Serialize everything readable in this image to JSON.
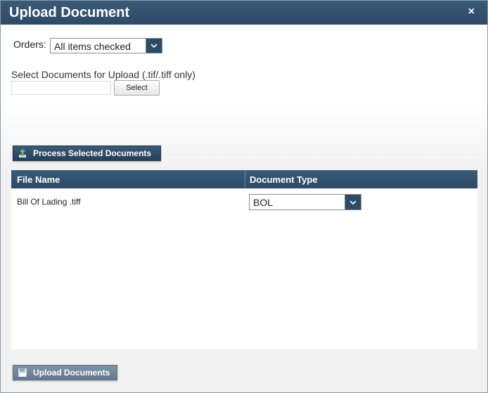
{
  "dialog": {
    "title": "Upload Document",
    "close_label": "×"
  },
  "orders": {
    "label": "Orders:",
    "selected": "All items checked"
  },
  "upload": {
    "label": "Select Documents for Upload (.tif/.tiff only)",
    "file_value": "",
    "select_button": "Select"
  },
  "process_button": "Process Selected Documents",
  "grid": {
    "columns": [
      "File Name",
      "Document Type"
    ],
    "rows": [
      {
        "file_name": "Bill Of Lading .tiff",
        "document_type": "BOL"
      }
    ]
  },
  "upload_button": "Upload Documents",
  "colors": {
    "header": "#2d4a66",
    "button_dark": "#2d4a66",
    "button_disabled": "#6f869b"
  }
}
